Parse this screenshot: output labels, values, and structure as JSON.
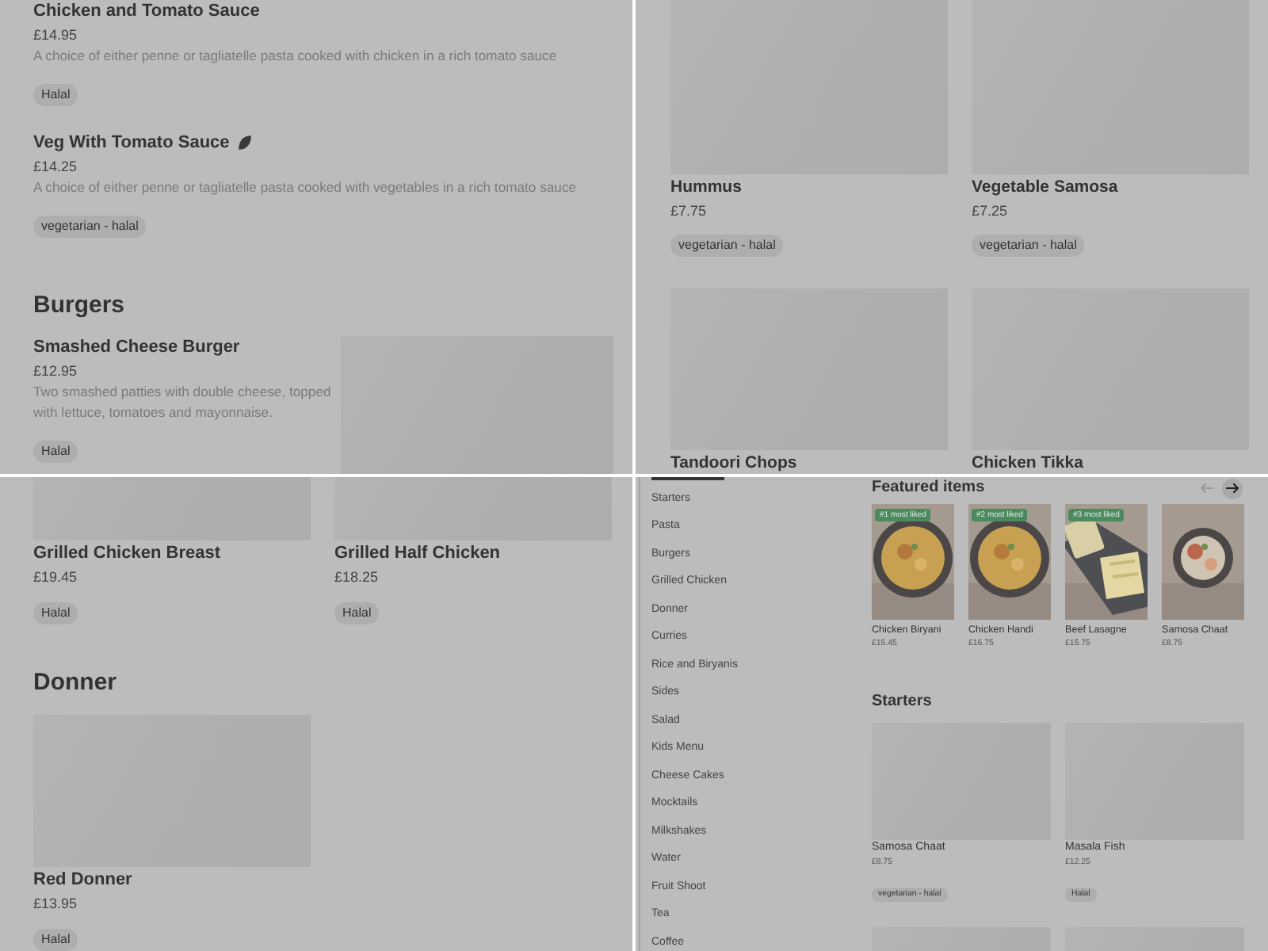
{
  "pasta_panel": {
    "items": [
      {
        "name": "Chicken and Tomato Sauce",
        "price": "£14.95",
        "description": "A choice of either penne or tagliatelle pasta cooked with chicken in a rich tomato sauce",
        "tag": "Halal",
        "vegetarian_icon": false
      },
      {
        "name": "Veg With Tomato Sauce",
        "price": "£14.25",
        "description": "A choice of either penne or tagliatelle pasta cooked with vegetables in a rich tomato sauce",
        "tag": "vegetarian - halal",
        "vegetarian_icon": true
      }
    ],
    "section": {
      "title": "Burgers",
      "items": [
        {
          "name": "Smashed Cheese Burger",
          "price": "£12.95",
          "description": "Two smashed patties with double cheese, topped with lettuce, tomatoes and mayonnaise.",
          "tag": "Halal"
        }
      ]
    }
  },
  "starters_grid_panel": {
    "items": [
      {
        "name": "Hummus",
        "price": "£7.75",
        "tag": "vegetarian - halal"
      },
      {
        "name": "Vegetable Samosa",
        "price": "£7.25",
        "tag": "vegetarian - halal"
      },
      {
        "name": "Tandoori Chops"
      },
      {
        "name": "Chicken Tikka"
      }
    ]
  },
  "grilled_panel": {
    "items": [
      {
        "name": "Grilled Chicken Breast",
        "price": "£19.45",
        "tag": "Halal"
      },
      {
        "name": "Grilled Half Chicken",
        "price": "£18.25",
        "tag": "Halal"
      }
    ],
    "section": {
      "title": "Donner",
      "items": [
        {
          "name": "Red Donner",
          "price": "£13.95",
          "tag": "Halal"
        }
      ]
    }
  },
  "menu_page": {
    "categories": [
      "Starters",
      "Pasta",
      "Burgers",
      "Grilled Chicken",
      "Donner",
      "Curries",
      "Rice and Biryanis",
      "Sides",
      "Salad",
      "Kids Menu",
      "Cheese Cakes",
      "Mocktails",
      "Milkshakes",
      "Water",
      "Fruit Shoot",
      "Tea",
      "Coffee"
    ],
    "featured": {
      "title": "Featured items",
      "prev_button": {
        "disabled": true
      },
      "next_button": {
        "disabled": false
      },
      "items": [
        {
          "badge": "#1 most liked",
          "name": "Chicken Biryani",
          "price": "£15.45"
        },
        {
          "badge": "#2 most liked",
          "name": "Chicken Handi",
          "price": "£16.75"
        },
        {
          "badge": "#3 most liked",
          "name": "Beef Lasagne",
          "price": "£15.75"
        },
        {
          "name": "Samosa Chaat",
          "price": "£8.75"
        }
      ]
    },
    "starters": {
      "title": "Starters",
      "items": [
        {
          "name": "Samosa Chaat",
          "price": "£8.75",
          "tag": "vegetarian - halal"
        },
        {
          "name": "Masala Fish",
          "price": "£12.25",
          "tag": "Halal"
        },
        {
          "kind": "picture"
        },
        {
          "kind": "picture"
        }
      ]
    }
  }
}
